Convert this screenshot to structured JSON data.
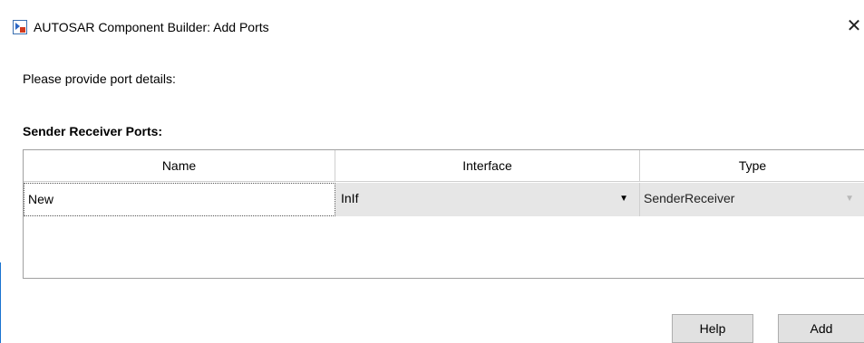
{
  "window": {
    "title": "AUTOSAR Component Builder: Add Ports",
    "close_glyph": "✕"
  },
  "prompt": "Please provide port details:",
  "section_label": "Sender Receiver Ports:",
  "table": {
    "columns": [
      "Name",
      "Interface",
      "Type"
    ],
    "rows": [
      {
        "name": "New",
        "interface": "InIf",
        "type": "SenderReceiver"
      }
    ]
  },
  "buttons": {
    "help": "Help",
    "add": "Add"
  },
  "icons": {
    "app": "simulink-app-icon",
    "dropdown": "chevron-down-icon"
  },
  "colors": {
    "selected_cell_bg": "#e6e6e6",
    "button_bg": "#e1e1e1"
  }
}
